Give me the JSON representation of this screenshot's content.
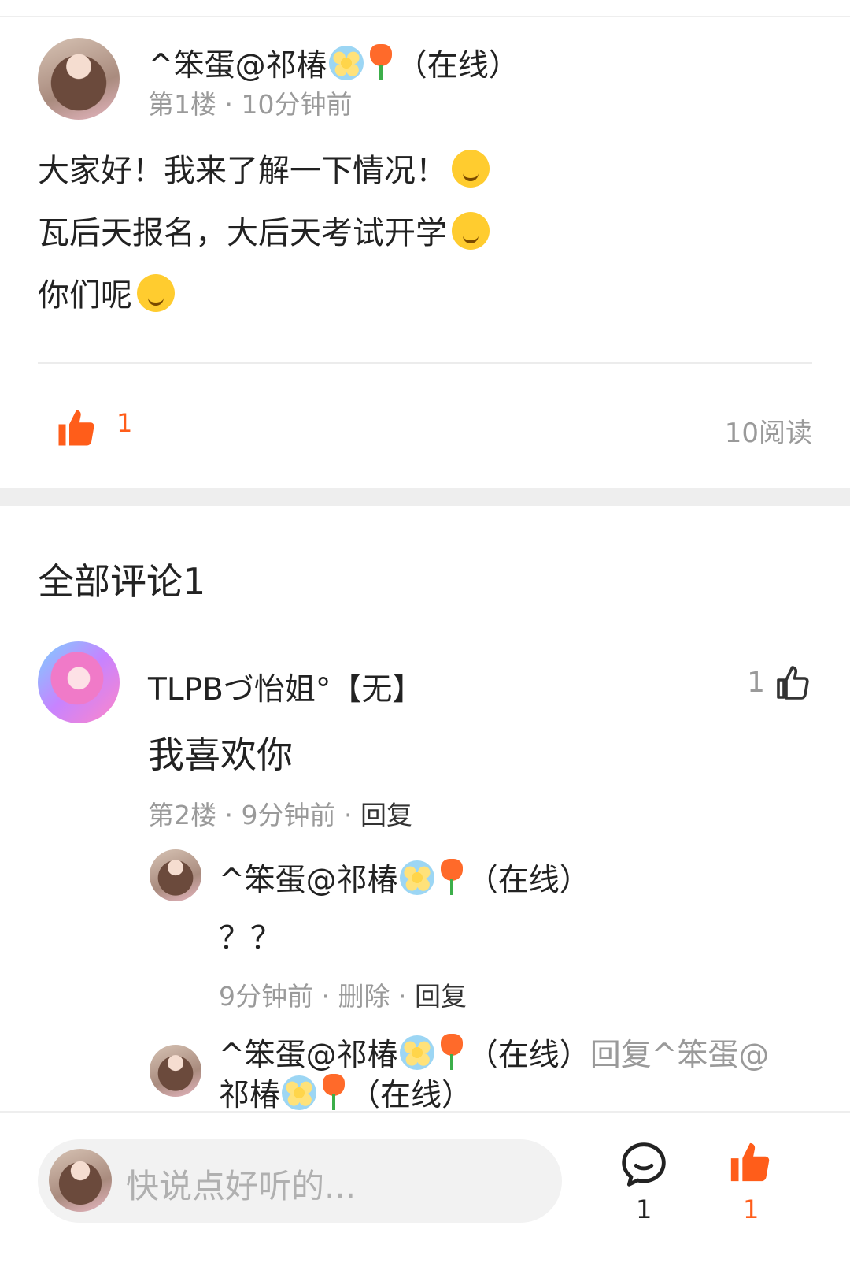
{
  "post": {
    "author": "^笨蛋@祁椿",
    "status": "（在线）",
    "floor": "第1楼",
    "time": "10分钟前",
    "lines": [
      "大家好！我来了解一下情况！",
      "瓦后天报名，大后天考试开学",
      "你们呢"
    ],
    "emojis": [
      "surprised-emoji",
      "smile-emoji",
      "wink-emoji"
    ],
    "likes": "1",
    "reads": "10阅读"
  },
  "comments": {
    "title": "全部评论1",
    "items": [
      {
        "author": "TLPBづ怡姐°【无】",
        "likes": "1",
        "text": "我喜欢你",
        "floor": "第2楼",
        "time": "9分钟前",
        "reply_label": "回复",
        "replies": [
          {
            "author": "^笨蛋@祁椿",
            "status": "（在线）",
            "text": "？？",
            "time": "9分钟前",
            "delete_label": "删除",
            "reply_label": "回复"
          },
          {
            "author": "^笨蛋@祁椿",
            "status": "（在线）",
            "reply_to_label": "回复^笨蛋@",
            "reply_to_name2": "祁椿",
            "reply_to_status": "（在线）"
          }
        ]
      }
    ]
  },
  "bottom_bar": {
    "placeholder": "快说点好听的...",
    "comment_count": "1",
    "like_count": "1"
  },
  "colors": {
    "accent": "#ff5d1a",
    "muted": "#9a9a9a",
    "text": "#222222"
  }
}
